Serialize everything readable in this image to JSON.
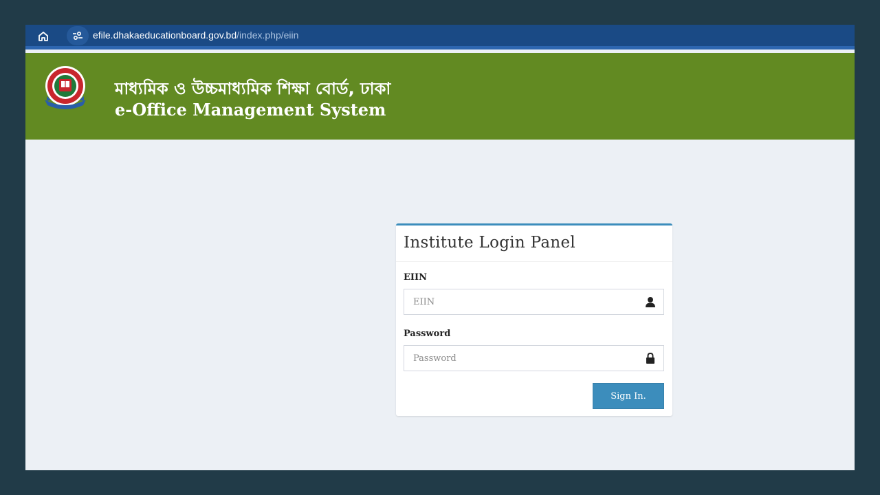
{
  "browser": {
    "url_domain": "efile.dhakaeducationboard.gov.bd",
    "url_path": "/index.php/eiin",
    "icons": {
      "home": "home-icon",
      "site_info": "site-settings-icon"
    }
  },
  "header": {
    "title_bn": "মাধ্যমিক ও উচ্চমাধ্যমিক শিক্ষা বোর্ড, ঢাকা",
    "title_en": "e-Office Management System",
    "background_color": "#628a22"
  },
  "login": {
    "title": "Institute Login Panel",
    "eiin_label": "EIIN",
    "eiin_placeholder": "EIIN",
    "eiin_value": "",
    "eiin_icon": "user-icon",
    "password_label": "Password",
    "password_placeholder": "Password",
    "password_value": "",
    "password_icon": "lock-icon",
    "signin_label": "Sign In.",
    "accent_color": "#3c8dbc"
  }
}
